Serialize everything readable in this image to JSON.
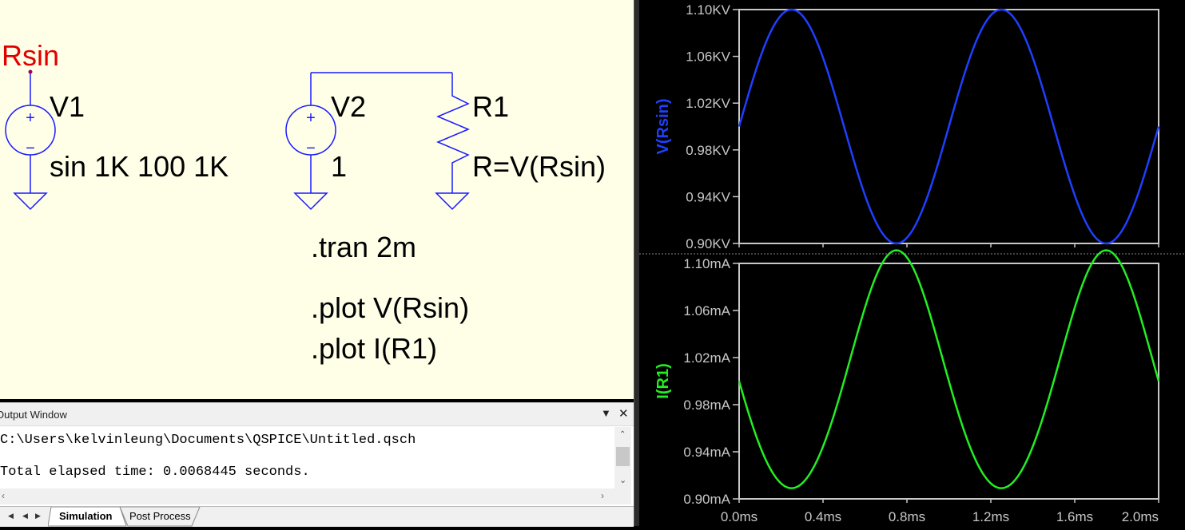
{
  "schematic": {
    "net_label": "Rsin",
    "v1": {
      "name": "V1",
      "value": "sin 1K 100 1K"
    },
    "v2": {
      "name": "V2",
      "value": "1"
    },
    "r1": {
      "name": "R1",
      "value": "R=V(Rsin)"
    },
    "directives": [
      ".tran 2m",
      ".plot V(Rsin)",
      ".plot I(R1)"
    ],
    "colors": {
      "background": "#ffffe8",
      "source": "#1a1aff",
      "net_label": "#e00000",
      "wire": "#1a1aff",
      "text": "#000000"
    }
  },
  "output_window": {
    "title": "Output Window",
    "dropdown_icon": "chevron-down-icon",
    "close_icon": "close-icon",
    "lines": [
      "C:\\Users\\kelvinleung\\Documents\\QSPICE\\Untitled.qsch",
      "Total elapsed time: 0.0068445 seconds."
    ]
  },
  "tabs": {
    "items": [
      {
        "label": "Simulation",
        "active": true
      },
      {
        "label": "Post Process",
        "active": false
      }
    ]
  },
  "chart_data": [
    {
      "type": "line",
      "ylabel": "V(Rsin)",
      "x_ticks": [
        "0.0ms",
        "0.4ms",
        "0.8ms",
        "1.2ms",
        "1.6ms",
        "2.0ms"
      ],
      "xlim": [
        0,
        2.0
      ],
      "x_unit": "ms",
      "yticks": [
        "0.90KV",
        "0.94KV",
        "0.98KV",
        "1.02KV",
        "1.06KV",
        "1.10KV"
      ],
      "ylim": [
        0.9,
        1.1
      ],
      "y_unit": "KV",
      "series": [
        {
          "color": "#1f3fff",
          "waveform": "sine",
          "offset": 1.0,
          "amplitude": 0.1,
          "frequency_khz": 1.0,
          "x": [
            0,
            0.25,
            0.5,
            0.75,
            1.0,
            1.25,
            1.5,
            1.75,
            2.0
          ],
          "values": [
            1.0,
            1.1,
            1.0,
            0.9,
            1.0,
            1.1,
            1.0,
            0.9,
            1.0
          ]
        }
      ],
      "grid": false
    },
    {
      "type": "line",
      "ylabel": "I(R1)",
      "x_ticks": [
        "0.0ms",
        "0.4ms",
        "0.8ms",
        "1.2ms",
        "1.6ms",
        "2.0ms"
      ],
      "xlim": [
        0,
        2.0
      ],
      "x_unit": "ms",
      "yticks": [
        "0.90mA",
        "0.94mA",
        "0.98mA",
        "1.02mA",
        "1.06mA",
        "1.10mA"
      ],
      "ylim": [
        0.9,
        1.1
      ],
      "y_unit": "mA",
      "series": [
        {
          "color": "#22ee22",
          "waveform": "reciprocal",
          "x": [
            0,
            0.25,
            0.5,
            0.75,
            1.0,
            1.25,
            1.5,
            1.75,
            2.0
          ],
          "values": [
            1.0,
            0.909,
            1.0,
            1.111,
            1.0,
            0.909,
            1.0,
            1.111,
            1.0
          ]
        }
      ],
      "grid": false
    }
  ]
}
